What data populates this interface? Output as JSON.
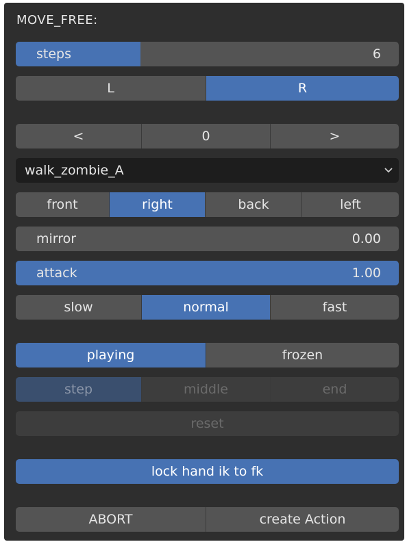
{
  "panel_title": "MOVE_FREE:",
  "steps": {
    "label": "steps",
    "value": "6",
    "fill_fraction": 0.33
  },
  "side": {
    "left": "L",
    "right": "R",
    "selected": "R"
  },
  "nav": {
    "prev": "<",
    "index": "0",
    "next": ">"
  },
  "action_select": {
    "value": "walk_zombie_A"
  },
  "direction": {
    "options": [
      "front",
      "right",
      "back",
      "left"
    ],
    "selected": "right"
  },
  "mirror": {
    "label": "mirror",
    "value": "0.00",
    "fill_fraction": 0.0
  },
  "attack": {
    "label": "attack",
    "value": "1.00",
    "fill_fraction": 1.0
  },
  "speed": {
    "options": [
      "slow",
      "normal",
      "fast"
    ],
    "selected": "normal"
  },
  "playback": {
    "options": [
      "playing",
      "frozen"
    ],
    "selected": "playing"
  },
  "frame_mode": {
    "options": [
      "step",
      "middle",
      "end"
    ],
    "selected": "step"
  },
  "reset_label": "reset",
  "lock_hand_label": "lock hand ik to fk",
  "bottom": {
    "abort": "ABORT",
    "create": "create Action"
  },
  "colors": {
    "panel": "#2e2e2e",
    "button": "#545454",
    "accent": "#4772b3",
    "field_dark": "#1d1d1d"
  }
}
